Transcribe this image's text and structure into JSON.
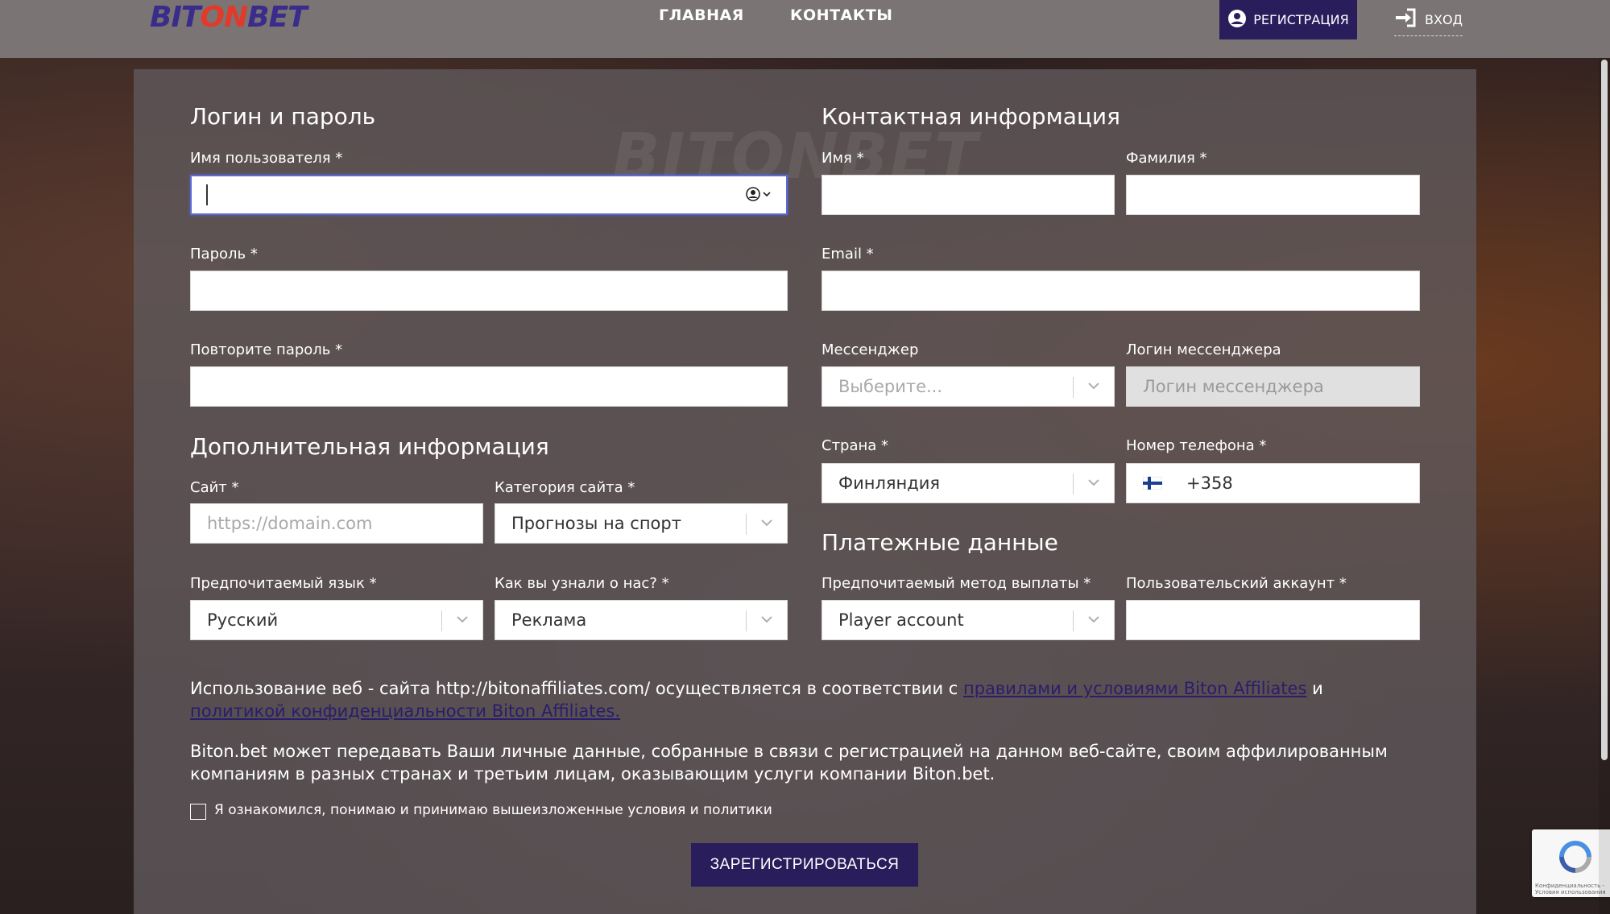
{
  "header": {
    "logo": {
      "part1": "BIT",
      "part2": "ON",
      "part3": "BET"
    },
    "nav": [
      {
        "label": "ГЛАВНАЯ"
      },
      {
        "label": "КОНТАКТЫ"
      }
    ],
    "register_label": "РЕГИСТРАЦИЯ",
    "login_label": "ВХОД"
  },
  "watermark": "BITONBET",
  "login": {
    "title": "Логин и пароль",
    "username_label": "Имя пользователя *",
    "password_label": "Пароль *",
    "repeat_password_label": "Повторите пароль *"
  },
  "contact": {
    "title": "Контактная информация",
    "first_name_label": "Имя *",
    "last_name_label": "Фамилия *",
    "email_label": "Email *",
    "messenger_label": "Мессенджер",
    "messenger_placeholder": "Выберите...",
    "messenger_login_label": "Логин мессенджера",
    "messenger_login_placeholder": "Логин мессенджера",
    "country_label": "Страна *",
    "country_value": "Финляндия",
    "phone_label": "Номер телефона *",
    "phone_value": "+358"
  },
  "additional": {
    "title": "Дополнительная информация",
    "site_label": "Сайт *",
    "site_placeholder": "https://domain.com",
    "category_label": "Категория сайта *",
    "category_value": "Прогнозы на спорт",
    "language_label": "Предпочитаемый язык *",
    "language_value": "Русский",
    "source_label": "Как вы узнали о нас? *",
    "source_value": "Реклама"
  },
  "payment": {
    "title": "Платежные данные",
    "method_label": "Предпочитаемый метод выплаты *",
    "method_value": "Player account",
    "account_label": "Пользовательский аккаунт *"
  },
  "legal": {
    "p1_text": "Использование веб - сайта http://bitonaffiliates.com/ осуществляется в соответствии с ",
    "p1_link1": "правилами и условиями Biton Affiliates",
    "p1_and": " и ",
    "p1_link2": "политикой конфиденциальности Biton Affiliates.",
    "p2": "Biton.bet может передавать Ваши личные данные, собранные в связи с регистрацией на данном веб-сайте, своим аффилированным компаниям в разных странах и третьим лицам, оказывающим услуги компании Biton.bet.",
    "checkbox_label": "Я ознакомился, понимаю и принимаю вышеизложенные условия и политики"
  },
  "submit_label": "ЗАРЕГИСТРИРОВАТЬСЯ",
  "recaptcha_text": "Конфиденциальность - Условия использования",
  "colors": {
    "header_bg": "#7a7474",
    "accent": "#2a1d5c",
    "logo_red": "#e23a2a",
    "panel_bg": "#5f585a"
  }
}
